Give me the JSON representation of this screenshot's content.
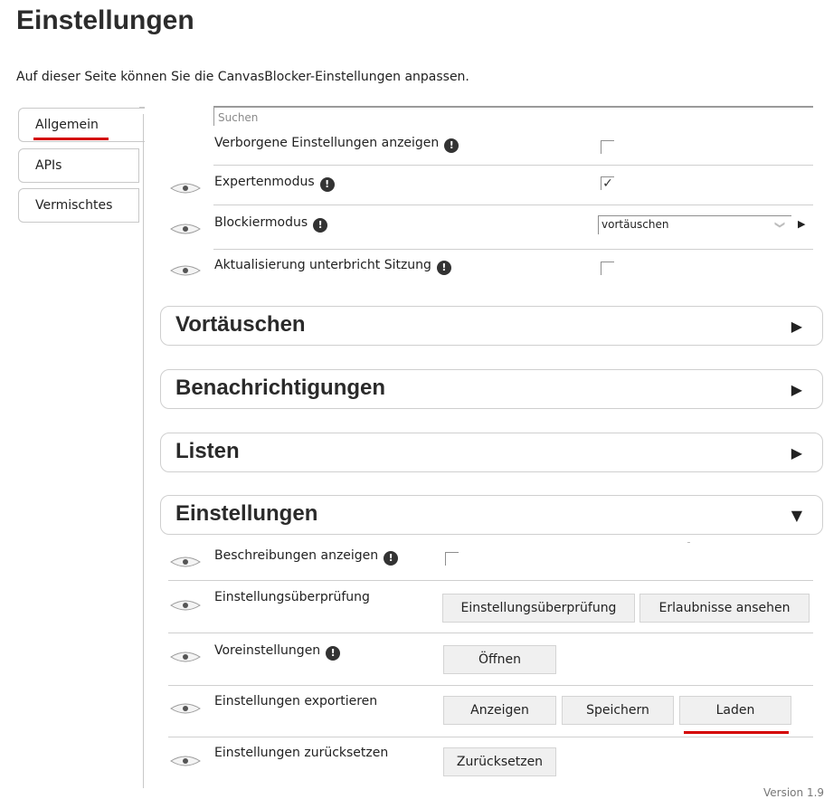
{
  "page": {
    "title": "Einstellungen",
    "description": "Auf dieser Seite können Sie die CanvasBlocker-Einstellungen anpassen.",
    "version": "Version 1.9"
  },
  "tabs": [
    {
      "label": "Allgemein",
      "active": true
    },
    {
      "label": "APIs",
      "active": false
    },
    {
      "label": "Vermischtes",
      "active": false
    }
  ],
  "search": {
    "placeholder": "Suchen",
    "value": ""
  },
  "general": {
    "hidden_settings": {
      "label": "Verborgene Einstellungen anzeigen",
      "checked": false
    },
    "expert_mode": {
      "label": "Expertenmodus",
      "checked": true,
      "check_glyph": "✓"
    },
    "block_mode": {
      "label": "Blockiermodus",
      "value": "vortäuschen",
      "chevron": "❯"
    },
    "update_interrupts": {
      "label": "Aktualisierung unterbricht Sitzung",
      "checked": false
    }
  },
  "info_glyph": "!",
  "arrows": {
    "collapsed": "▶",
    "expanded": "▼",
    "small": "▶"
  },
  "sections": [
    {
      "title": "Vortäuschen",
      "expanded": false
    },
    {
      "title": "Benachrichtigungen",
      "expanded": false
    },
    {
      "title": "Listen",
      "expanded": false
    },
    {
      "title": "Einstellungen",
      "expanded": true
    }
  ],
  "settings": {
    "show_descriptions": {
      "label": "Beschreibungen anzeigen",
      "checked": false
    },
    "settings_check": {
      "label": "Einstellungsüberprüfung",
      "buttons": [
        "Einstellungsüberprüfung",
        "Erlaubnisse ansehen"
      ]
    },
    "presets": {
      "label": "Voreinstellungen",
      "button": "Öffnen"
    },
    "export": {
      "label": "Einstellungen exportieren",
      "buttons": [
        "Anzeigen",
        "Speichern",
        "Laden"
      ]
    },
    "reset": {
      "label": "Einstellungen zurücksetzen",
      "button": "Zurücksetzen"
    }
  },
  "colors": {
    "accent_underline": "#d40000",
    "border": "#c8c8c8",
    "button_bg": "#f0f0f0"
  }
}
